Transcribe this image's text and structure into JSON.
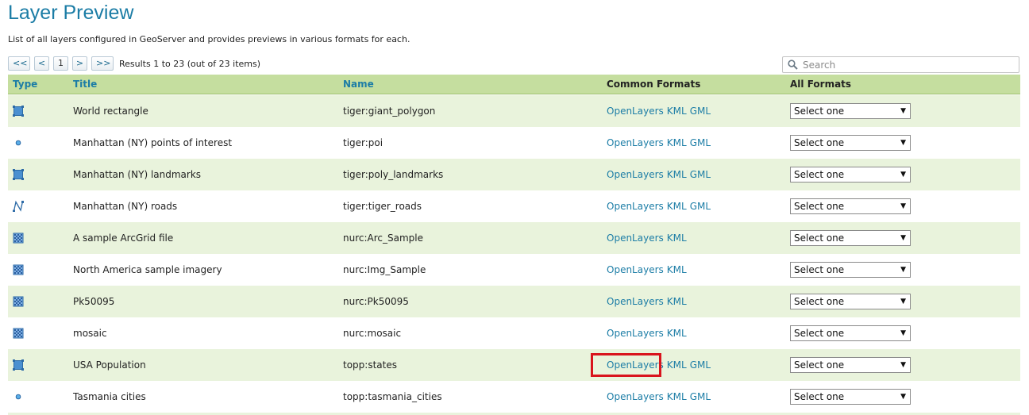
{
  "page": {
    "title": "Layer Preview",
    "description": "List of all layers configured in GeoServer and provides previews in various formats for each."
  },
  "pager": {
    "first": "<<",
    "prev": "<",
    "current": "1",
    "next": ">",
    "last": ">>",
    "results": "Results 1 to 23 (out of 23 items)"
  },
  "search": {
    "placeholder": "Search",
    "value": ""
  },
  "table": {
    "headers": {
      "type": "Type",
      "title": "Title",
      "name": "Name",
      "common": "Common Formats",
      "all": "All Formats"
    },
    "rows": [
      {
        "type_icon": "polygon-icon",
        "title": "World rectangle",
        "name": "tiger:giant_polygon",
        "formats": [
          "OpenLayers",
          "KML",
          "GML"
        ],
        "select": "Select one"
      },
      {
        "type_icon": "point-icon",
        "title": "Manhattan (NY) points of interest",
        "name": "tiger:poi",
        "formats": [
          "OpenLayers",
          "KML",
          "GML"
        ],
        "select": "Select one"
      },
      {
        "type_icon": "polygon-icon",
        "title": "Manhattan (NY) landmarks",
        "name": "tiger:poly_landmarks",
        "formats": [
          "OpenLayers",
          "KML",
          "GML"
        ],
        "select": "Select one"
      },
      {
        "type_icon": "line-icon",
        "title": "Manhattan (NY) roads",
        "name": "tiger:tiger_roads",
        "formats": [
          "OpenLayers",
          "KML",
          "GML"
        ],
        "select": "Select one"
      },
      {
        "type_icon": "raster-icon",
        "title": "A sample ArcGrid file",
        "name": "nurc:Arc_Sample",
        "formats": [
          "OpenLayers",
          "KML"
        ],
        "select": "Select one"
      },
      {
        "type_icon": "raster-icon",
        "title": "North America sample imagery",
        "name": "nurc:Img_Sample",
        "formats": [
          "OpenLayers",
          "KML"
        ],
        "select": "Select one"
      },
      {
        "type_icon": "raster-icon",
        "title": "Pk50095",
        "name": "nurc:Pk50095",
        "formats": [
          "OpenLayers",
          "KML"
        ],
        "select": "Select one"
      },
      {
        "type_icon": "raster-icon",
        "title": "mosaic",
        "name": "nurc:mosaic",
        "formats": [
          "OpenLayers",
          "KML"
        ],
        "select": "Select one"
      },
      {
        "type_icon": "polygon-icon",
        "title": "USA Population",
        "name": "topp:states",
        "formats": [
          "OpenLayers",
          "KML",
          "GML"
        ],
        "select": "Select one"
      },
      {
        "type_icon": "point-icon",
        "title": "Tasmania cities",
        "name": "topp:tasmania_cities",
        "formats": [
          "OpenLayers",
          "KML",
          "GML"
        ],
        "select": "Select one"
      }
    ]
  },
  "colors": {
    "accent": "#1c7da6",
    "header_bg": "#c5de9f",
    "row_alt_bg": "#e9f3dc",
    "highlight": "#d9141d"
  }
}
